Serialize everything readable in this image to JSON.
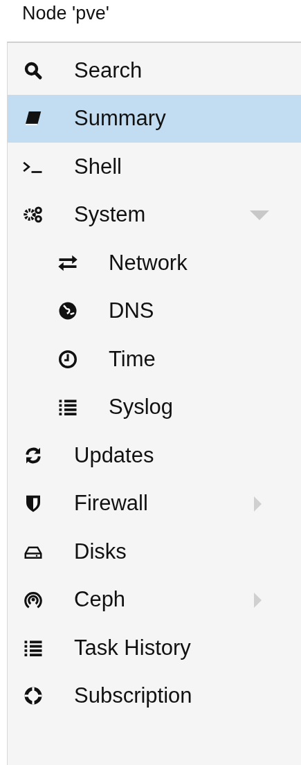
{
  "header": {
    "title": "Node 'pve'"
  },
  "nav": [
    {
      "label": "Search",
      "selected": false,
      "kind": "leaf"
    },
    {
      "label": "Summary",
      "selected": true,
      "kind": "leaf"
    },
    {
      "label": "Shell",
      "selected": false,
      "kind": "leaf"
    },
    {
      "label": "System",
      "selected": false,
      "kind": "group",
      "expanded": true,
      "children": [
        {
          "label": "Network",
          "selected": false
        },
        {
          "label": "DNS",
          "selected": false
        },
        {
          "label": "Time",
          "selected": false
        },
        {
          "label": "Syslog",
          "selected": false
        }
      ]
    },
    {
      "label": "Updates",
      "selected": false,
      "kind": "leaf"
    },
    {
      "label": "Firewall",
      "selected": false,
      "kind": "group",
      "expanded": false
    },
    {
      "label": "Disks",
      "selected": false,
      "kind": "leaf"
    },
    {
      "label": "Ceph",
      "selected": false,
      "kind": "group",
      "expanded": false
    },
    {
      "label": "Task History",
      "selected": false,
      "kind": "leaf"
    },
    {
      "label": "Subscription",
      "selected": false,
      "kind": "leaf"
    }
  ]
}
